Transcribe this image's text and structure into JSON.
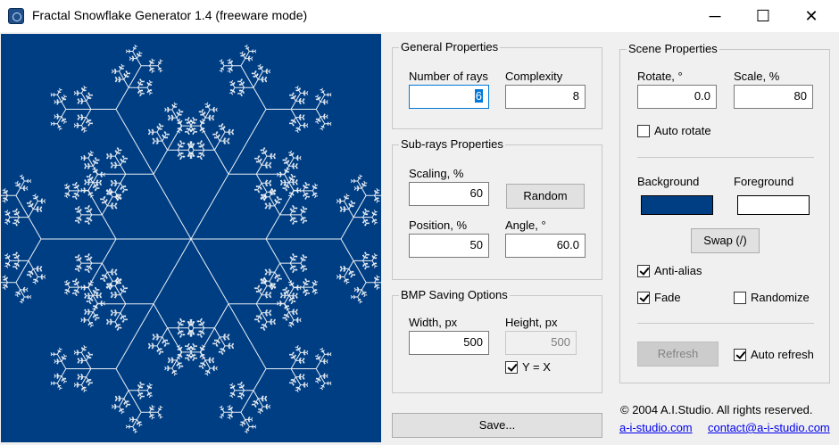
{
  "window": {
    "title": "Fractal Snowflake Generator 1.4 (freeware mode)",
    "minimize_glyph": "─",
    "maximize_glyph": "☐",
    "close_glyph": "✕"
  },
  "colors": {
    "canvas_bg": "#003e84",
    "snowflake": "#ffffff",
    "background_swatch": "#003e84",
    "foreground_swatch": "#ffffff"
  },
  "general": {
    "title": "General Properties",
    "rays_label": "Number of rays",
    "rays_value": "6",
    "complexity_label": "Complexity",
    "complexity_value": "8"
  },
  "subrays": {
    "title": "Sub-rays Properties",
    "scaling_label": "Scaling, %",
    "scaling_value": "60",
    "random_button": "Random",
    "position_label": "Position, %",
    "position_value": "50",
    "angle_label": "Angle, °",
    "angle_value": "60.0"
  },
  "bmp": {
    "title": "BMP Saving Options",
    "width_label": "Width, px",
    "width_value": "500",
    "height_label": "Height, px",
    "height_value": "500",
    "yx_label": "Y = X",
    "yx_checked": true
  },
  "save_button": "Save...",
  "scene": {
    "title": "Scene Properties",
    "rotate_label": "Rotate, °",
    "rotate_value": "0.0",
    "scale_label": "Scale, %",
    "scale_value": "80",
    "auto_rotate_label": "Auto rotate",
    "auto_rotate_checked": false,
    "background_label": "Background",
    "foreground_label": "Foreground",
    "swap_button": "Swap (/)",
    "antialias_label": "Anti-alias",
    "antialias_checked": true,
    "fade_label": "Fade",
    "fade_checked": true,
    "randomize_label": "Randomize",
    "randomize_checked": false,
    "refresh_button": "Refresh",
    "auto_refresh_label": "Auto refresh",
    "auto_refresh_checked": true
  },
  "footer": {
    "copyright": "© 2004 A.I.Studio. All rights reserved.",
    "site_link": "a-i-studio.com",
    "email_link": "contact@a-i-studio.com"
  },
  "icons": {
    "app": "snowflake-app-icon",
    "minimize": "minimize-icon",
    "maximize": "maximize-icon",
    "close": "close-icon"
  }
}
